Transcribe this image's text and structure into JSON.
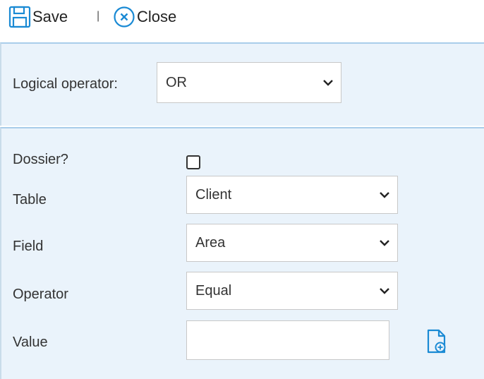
{
  "toolbar": {
    "save_label": "Save",
    "separator": "|",
    "close_label": "Close"
  },
  "logical_operator": {
    "label": "Logical operator:",
    "value": "OR"
  },
  "form": {
    "dossier": {
      "label": "Dossier?",
      "checked": false
    },
    "table": {
      "label": "Table",
      "value": "Client"
    },
    "field": {
      "label": "Field",
      "value": "Area"
    },
    "operator": {
      "label": "Operator",
      "value": "Equal"
    },
    "value": {
      "label": "Value",
      "input_value": ""
    }
  },
  "colors": {
    "accent": "#1a8ad4",
    "panel_background": "#eaf3fb",
    "panel_border": "#a9cdea"
  },
  "icons": {
    "save": "floppy-disk-icon",
    "close": "circle-x-icon",
    "chevron": "chevron-down-icon",
    "add_document": "document-add-icon"
  }
}
